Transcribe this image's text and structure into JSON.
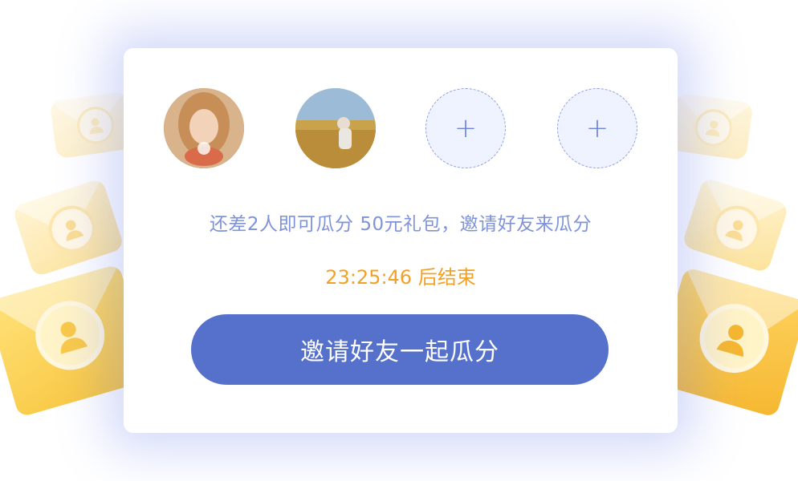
{
  "avatars": [
    {
      "name": "avatar-joined-1",
      "filled": true
    },
    {
      "name": "avatar-joined-2",
      "filled": true
    },
    {
      "name": "avatar-empty-slot",
      "filled": false,
      "symbol": "+"
    },
    {
      "name": "avatar-empty-slot",
      "filled": false,
      "symbol": "+"
    }
  ],
  "message": {
    "tip": "还差2人即可瓜分 50元礼包，邀请好友来瓜分",
    "countdown": "23:25:46 后结束"
  },
  "actions": {
    "invite_label": "邀请好友一起瓜分"
  },
  "colors": {
    "primary": "#5571cb",
    "tip_text": "#7f93d8",
    "countdown_text": "#f2a026",
    "envelope": "#f8c43c"
  },
  "icons": {
    "envelope": "envelope-user-icon",
    "add": "plus-icon"
  }
}
